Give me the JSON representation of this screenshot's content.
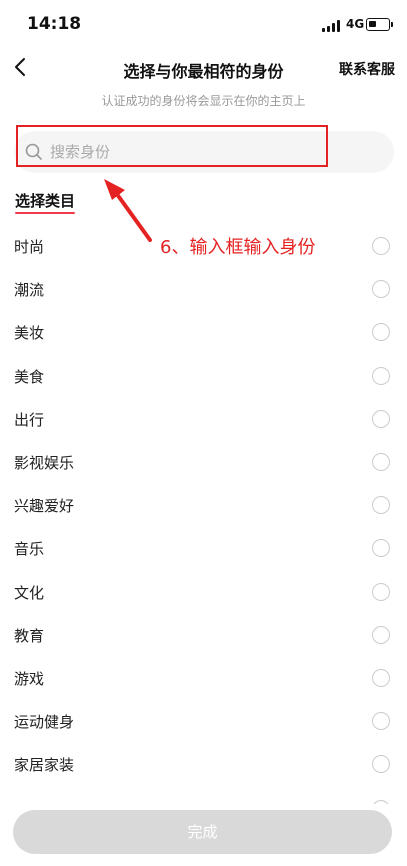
{
  "status_bar": {
    "time": "14:18",
    "network": "4G"
  },
  "header": {
    "title": "选择与你最相符的身份",
    "customer_service": "联系客服",
    "subtitle": "认证成功的身份将会显示在你的主页上"
  },
  "search": {
    "placeholder": "搜索身份",
    "value": ""
  },
  "annotation": {
    "text": "6、输入框输入身份",
    "color": "#e52222"
  },
  "category": {
    "title": "选择类目",
    "items": [
      {
        "label": "时尚"
      },
      {
        "label": "潮流"
      },
      {
        "label": "美妆"
      },
      {
        "label": "美食"
      },
      {
        "label": "出行"
      },
      {
        "label": "影视娱乐"
      },
      {
        "label": "兴趣爱好"
      },
      {
        "label": "音乐"
      },
      {
        "label": "文化"
      },
      {
        "label": "教育"
      },
      {
        "label": "游戏"
      },
      {
        "label": "运动健身"
      },
      {
        "label": "家居家装"
      }
    ]
  },
  "footer": {
    "done_label": "完成"
  },
  "colors": {
    "accent": "#ef3a4e",
    "button_disabled": "#d9d9d9",
    "annotation": "#e52222"
  }
}
